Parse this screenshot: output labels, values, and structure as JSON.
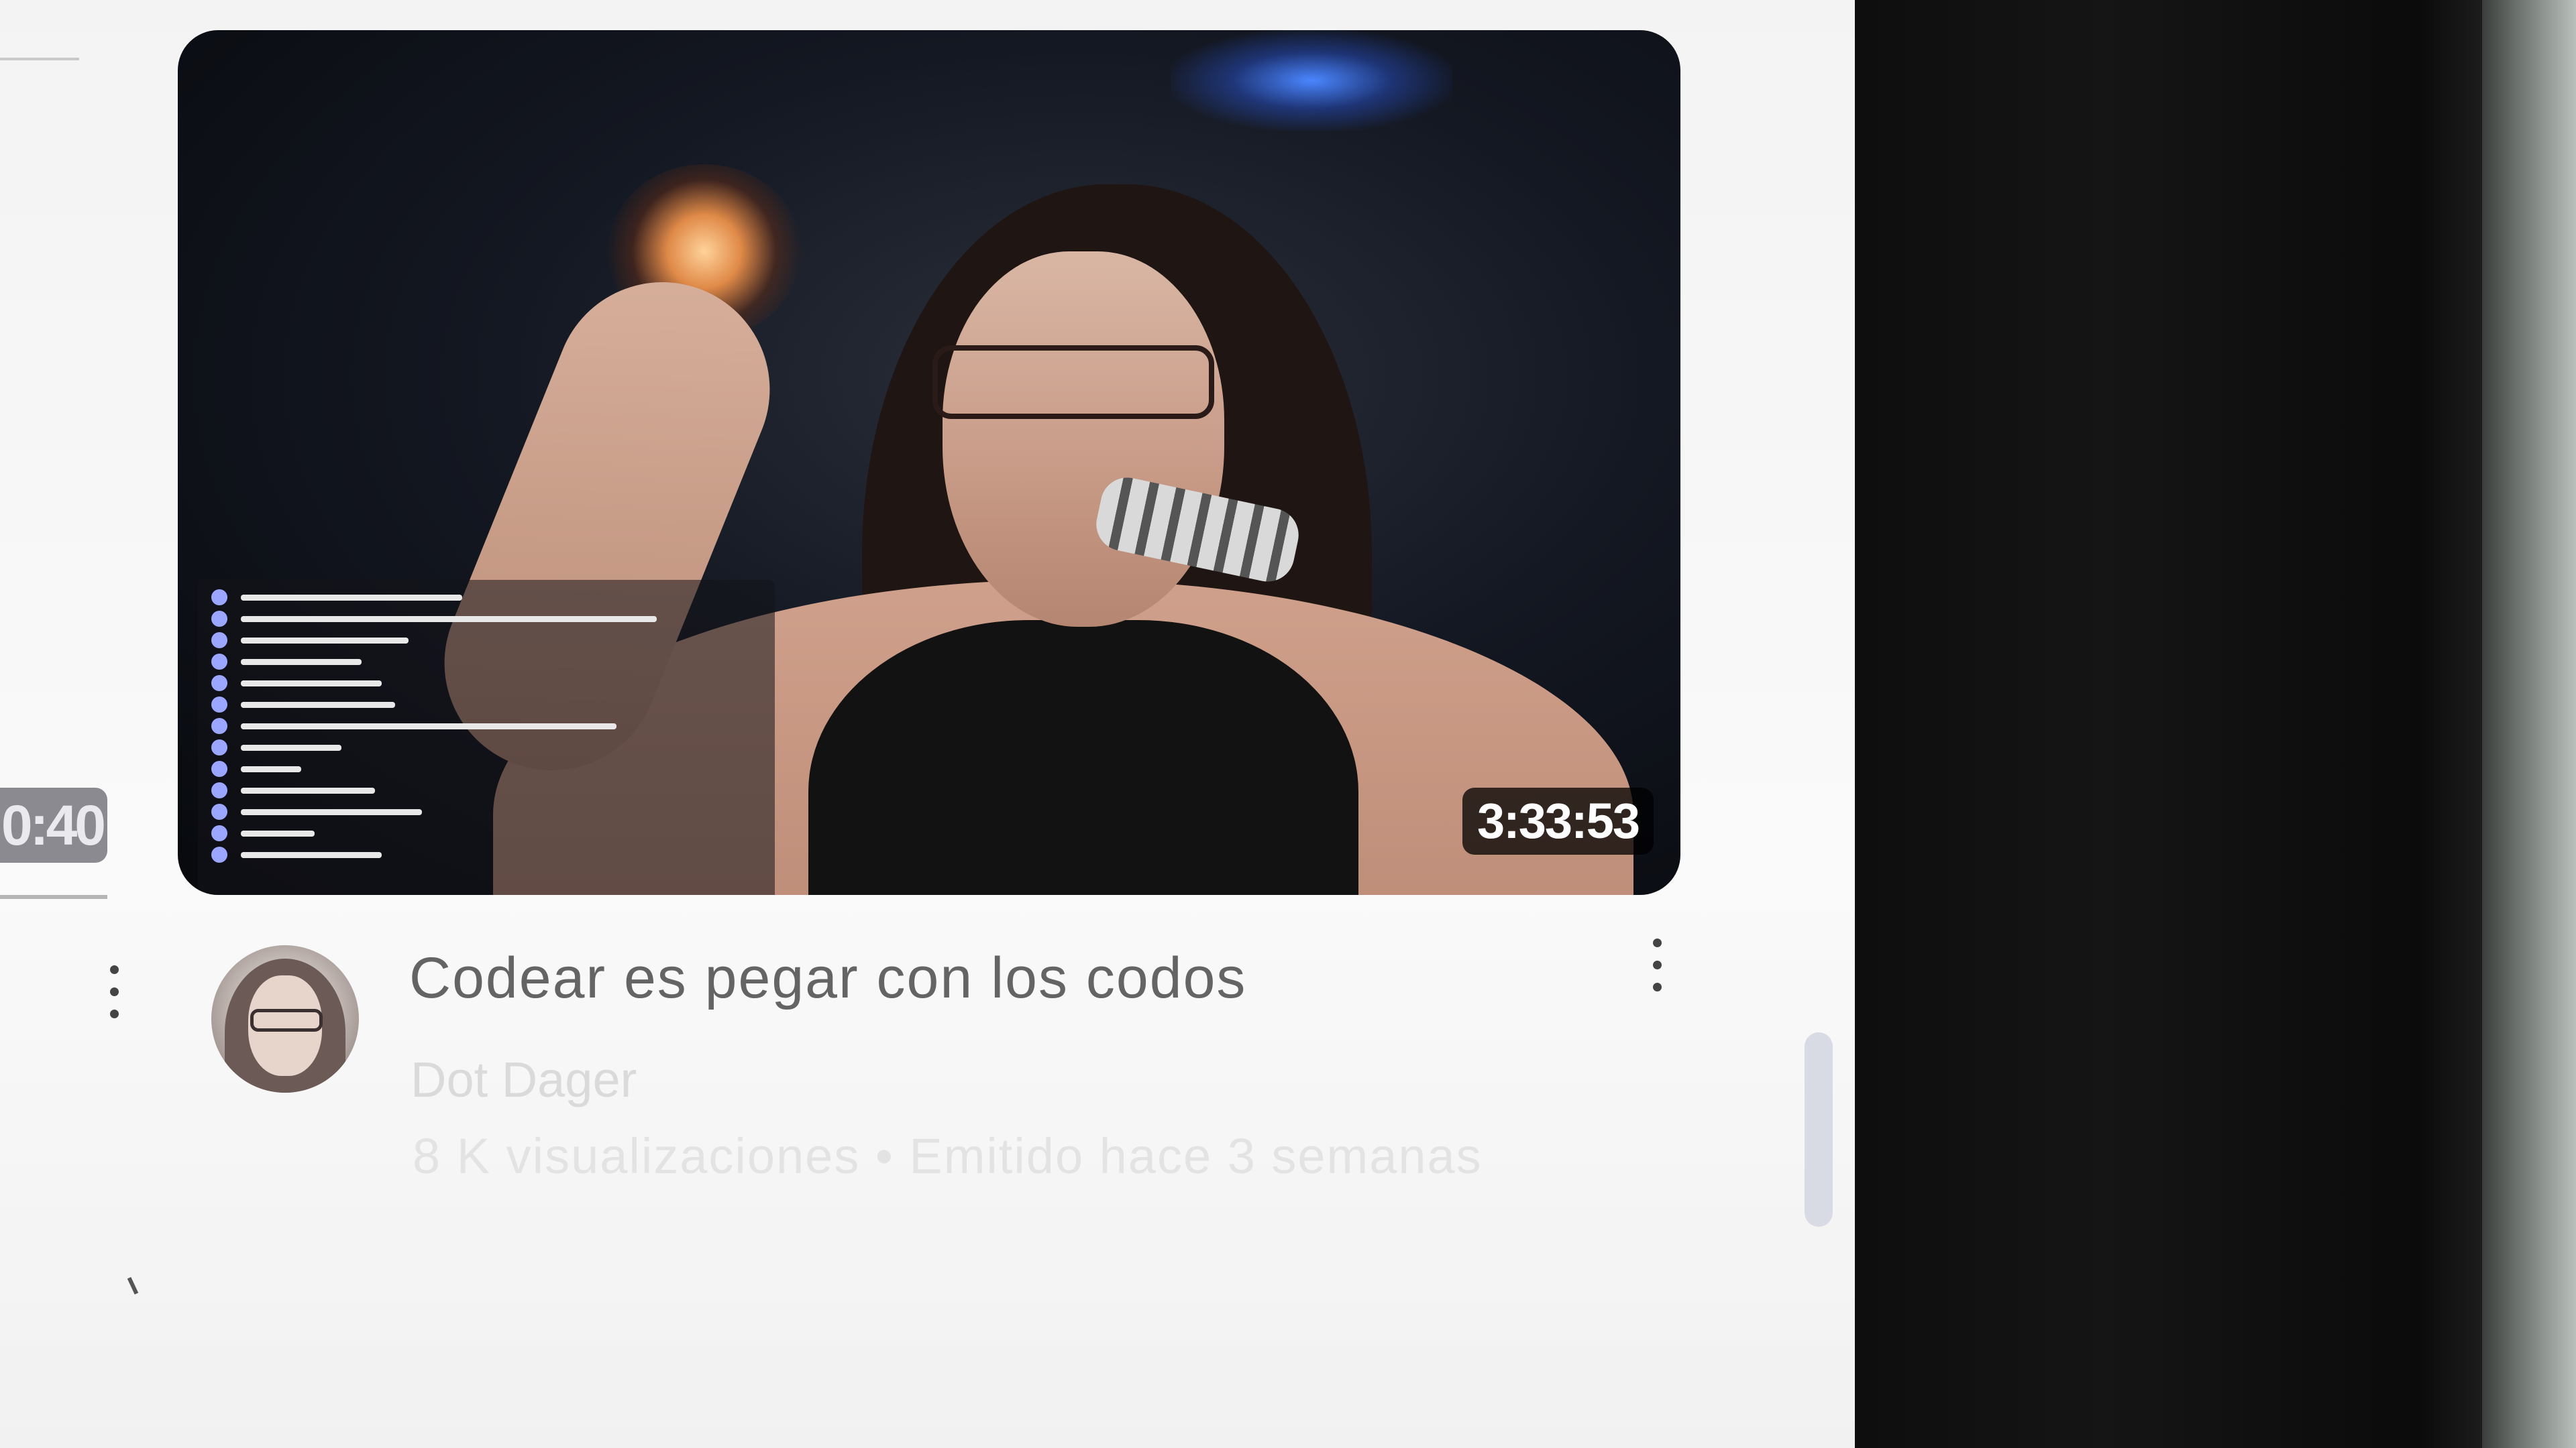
{
  "left_card": {
    "duration": "0:40"
  },
  "video": {
    "duration": "3:33:53",
    "title": "Codear es pegar con los codos",
    "channel": "Dot Dager",
    "stats": "8 K visualizaciones • Emitido hace 3 semanas"
  },
  "icons": {
    "video_menu": "kebab-menu-icon",
    "left_menu": "kebab-menu-icon",
    "avatar": "channel-avatar"
  },
  "colors": {
    "title": "#646464",
    "meta": "#dadada",
    "duration_badge_bg": "#000000",
    "duration_badge_text": "#ffffff"
  }
}
